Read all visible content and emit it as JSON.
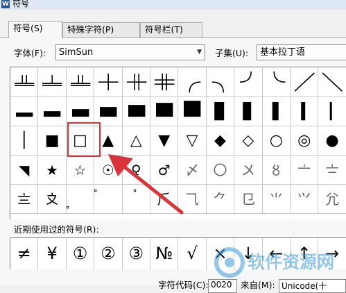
{
  "window": {
    "title": "符号",
    "icon": "word-doc-icon"
  },
  "tabs": [
    {
      "label": "符号(S)",
      "active": true
    },
    {
      "label": "特殊字符(P)",
      "active": false
    },
    {
      "label": "符号栏(T)",
      "active": false
    }
  ],
  "font": {
    "label": "字体(F):",
    "value": "SimSun"
  },
  "subset": {
    "label": "子集(U):",
    "value": "基本拉丁语"
  },
  "symbol_grid": {
    "rows": [
      [
        "┴",
        "┴",
        "┴",
        "┼",
        "╫",
        "╬",
        "◜",
        "◝",
        "◞",
        "◟",
        "╱",
        "╲"
      ],
      [
        "▁",
        "▂",
        "▃",
        "▄",
        "▅",
        "▆",
        "▇",
        "█",
        "▊",
        "▌",
        "▎",
        "▏"
      ],
      [
        "│",
        "■",
        "□",
        "▲",
        "△",
        "▼",
        "▽",
        "◆",
        "◇",
        "○",
        "◎",
        "●"
      ],
      [
        "◥",
        "★",
        "☆",
        "☉",
        "♀",
        "♂",
        "〆",
        "〇",
        "〤",
        "〥",
        "〦",
        "〧"
      ],
      [
        "〨",
        "〩",
        "〪",
        "〫",
        "〬",
        "⺁",
        "⺄",
        "⺈",
        "⺋",
        "⺌",
        "⺍",
        "⺑"
      ]
    ],
    "selected_row": 2,
    "selected_col": 2
  },
  "recent": {
    "label": "近期使用过的符号(R):",
    "symbols": [
      "≠",
      "¥",
      "①",
      "②",
      "③",
      "№",
      "√",
      "×",
      "↓",
      "←",
      "↑",
      "→"
    ]
  },
  "bottom": {
    "code_label": "字符代码(C):",
    "code_value": "0020",
    "from_label": "来自(M):",
    "from_value": "Unicode(十"
  },
  "watermark": {
    "text": "软件资源网"
  },
  "colors": {
    "highlight": "#d9343a",
    "arrow": "#d9343a",
    "watermark": "#3a9ad9"
  }
}
